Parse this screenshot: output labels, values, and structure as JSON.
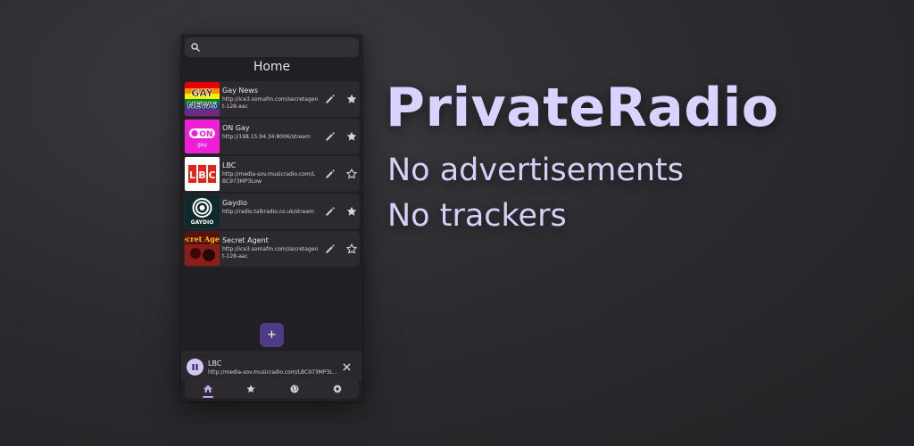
{
  "app": {
    "search": {
      "placeholder": ""
    },
    "page_title": "Home",
    "stations": [
      {
        "name": "Gay News",
        "url": "http://ice3.somafm.com/secretagent-128-aac",
        "logo": "GAY NEWS",
        "favorite": true
      },
      {
        "name": "ON Gay",
        "url": "http://198.15.94.34:8006/stream",
        "logo": "ON gay",
        "favorite": true
      },
      {
        "name": "LBC",
        "url": "http://media-sov.musicradio.com/LBC973MP3Low",
        "logo": "LBC",
        "favorite": false
      },
      {
        "name": "Gaydio",
        "url": "http://radio.talkradio.co.uk/stream",
        "logo": "GAYDIO",
        "favorite": true
      },
      {
        "name": "Secret Agent",
        "url": "http://ice3.somafm.com/secretagent-128-aac",
        "logo": "Secret Agent",
        "favorite": false
      }
    ],
    "add_button": "+",
    "now_playing": {
      "name": "LBC",
      "url": "http://media-sov.musicradio.com/LBC973MP3L..."
    },
    "nav": [
      {
        "icon": "home-icon",
        "active": true
      },
      {
        "icon": "star-icon",
        "active": false
      },
      {
        "icon": "globe-icon",
        "active": false
      },
      {
        "icon": "gear-icon",
        "active": false
      }
    ]
  },
  "promo": {
    "headline": "PrivateRadio",
    "features": [
      "No advertisements",
      "No trackers"
    ]
  },
  "colors": {
    "accent": "#d9d4ff",
    "fab": "#4f3a86",
    "pause": "#d7c5f7",
    "surface": "#2c2a2f"
  }
}
